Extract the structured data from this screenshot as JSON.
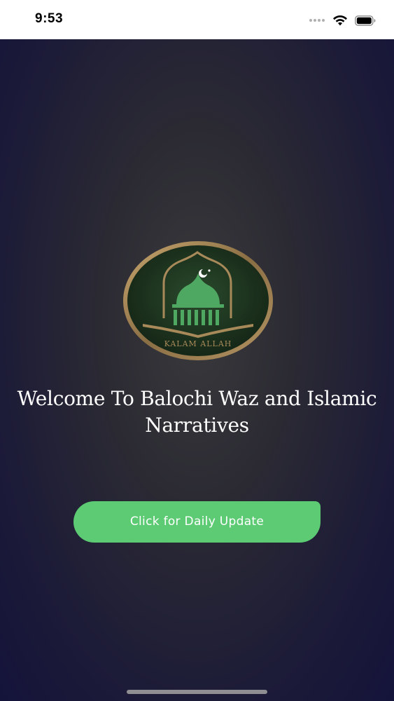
{
  "status_bar": {
    "time": "9:53",
    "icons": [
      "signal-dots-icon",
      "wifi-icon",
      "battery-icon"
    ]
  },
  "logo": {
    "caption": "KALAM ALLAH",
    "colors": {
      "ring": "#a88a5a",
      "inner": "#1f3a22",
      "mosque": "#4fa862"
    }
  },
  "welcome": {
    "text": "Welcome To Balochi Waz and Islamic Narratives"
  },
  "update_button": {
    "label": "Click for Daily Update",
    "color": "#5ccb74"
  },
  "theme": {
    "background_center": "#3a3a3c",
    "background_edge": "#14133a"
  }
}
